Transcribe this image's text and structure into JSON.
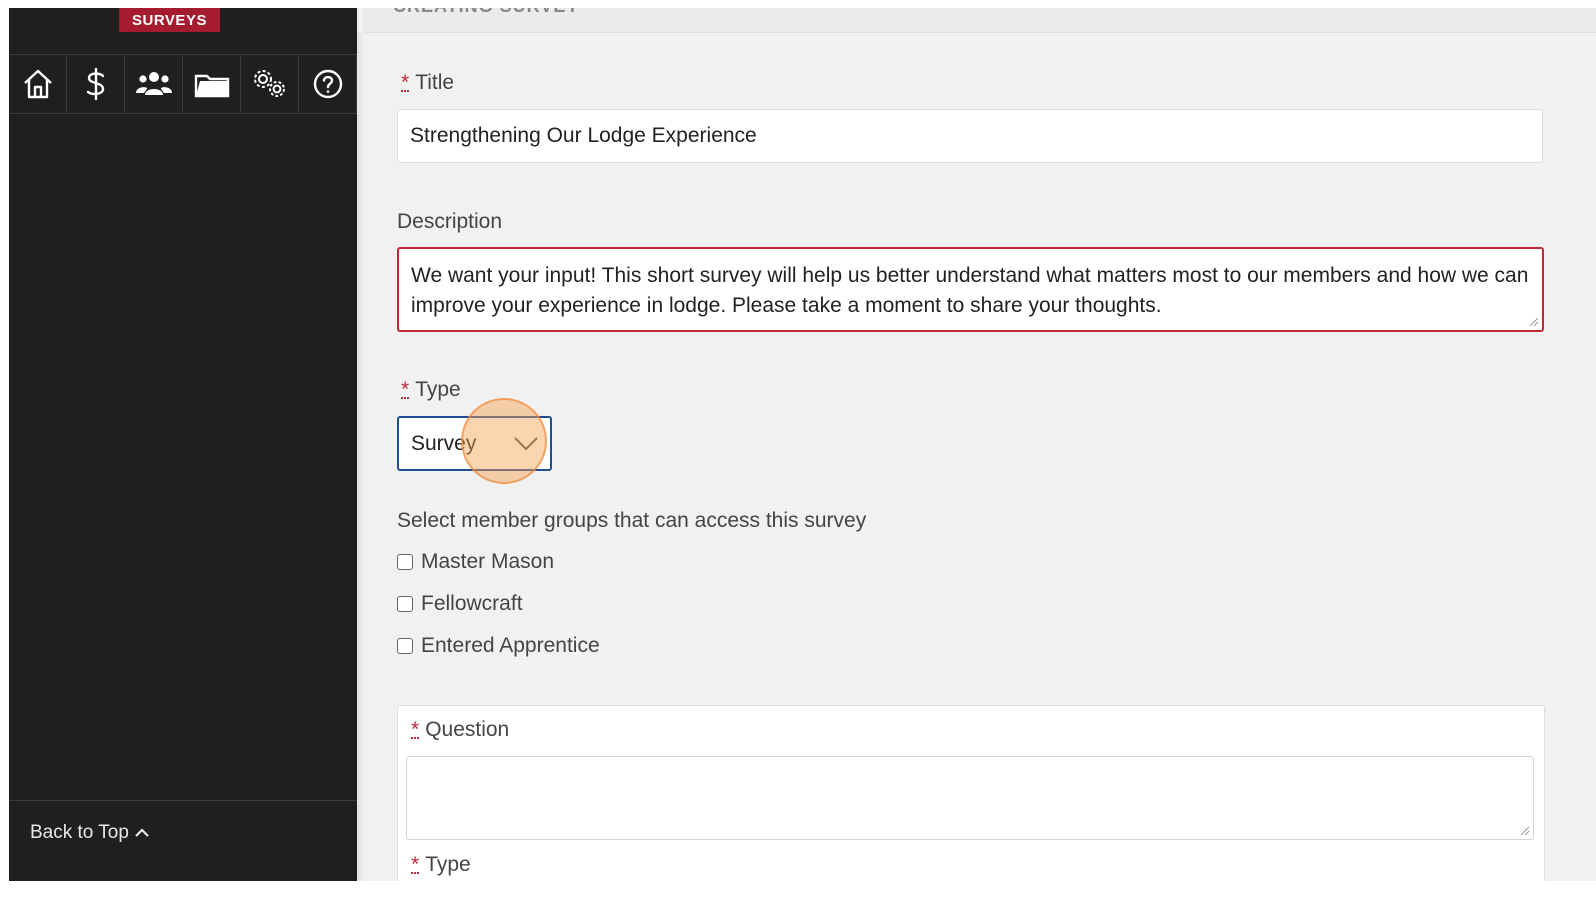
{
  "sidebar": {
    "brand_label": "SURVEYS",
    "icons": [
      {
        "name": "home-icon"
      },
      {
        "name": "dollar-icon"
      },
      {
        "name": "members-icon"
      },
      {
        "name": "folder-icon"
      },
      {
        "name": "settings-icon"
      },
      {
        "name": "help-icon"
      }
    ],
    "back_to_top": "Back to Top"
  },
  "main": {
    "header_text": "CREATING SURVEY",
    "title_label": "Title",
    "title_value": "Strengthening Our Lodge Experience",
    "description_label": "Description",
    "description_value": "We want your input! This short survey will help us better understand what matters most to our members and how we can improve your experience in lodge. Please take a moment to share your thoughts.",
    "type_label": "Type",
    "type_value": "Survey",
    "groups_label": "Select member groups that can access this survey",
    "groups": [
      {
        "label": "Master Mason",
        "checked": false
      },
      {
        "label": "Fellowcraft",
        "checked": false
      },
      {
        "label": "Entered Apprentice",
        "checked": false
      }
    ],
    "question_label": "Question",
    "question_value": "",
    "question_type_label": "Type",
    "required_marker": "*"
  },
  "colors": {
    "sidebar_bg": "#1f1f1f",
    "brand": "#a51c30",
    "required": "#c0293a",
    "focus_border": "#1f4f8f",
    "click_highlight": "#f7a050"
  }
}
